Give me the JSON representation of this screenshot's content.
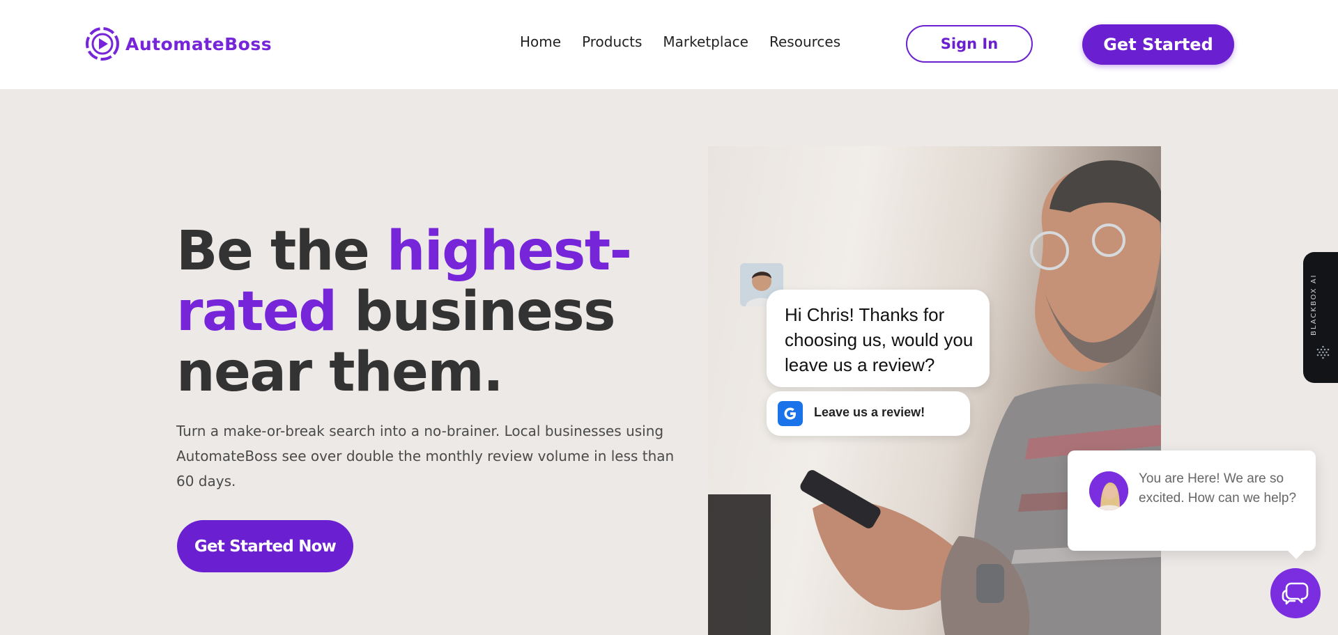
{
  "brand": {
    "name": "AutomateBoss",
    "color": "#7626d8"
  },
  "nav": {
    "items": [
      "Home",
      "Products",
      "Marketplace",
      "Resources"
    ]
  },
  "header": {
    "sign_in_label": "Sign In",
    "get_started_label": "Get Started"
  },
  "hero": {
    "title_part1": "Be the ",
    "title_accent1": "highest-",
    "title_accent2": "rated",
    "title_part2": " business",
    "title_part3": "near them.",
    "description": "Turn a make-or-break search into a no-brainer. Local businesses using AutomateBoss see over double the monthly review volume in less than 60 days.",
    "cta_label": "Get Started Now"
  },
  "image_overlay": {
    "message": "Hi Chris! Thanks for choosing us, would you leave us a review?",
    "review_button_label": "Leave us a review!",
    "google_icon": "google-g-icon"
  },
  "side_tab": {
    "label": "BLACKBOX AI"
  },
  "chat_widget": {
    "message": "You are Here! We are so excited. How can we help?",
    "icon": "chat-bubbles-icon"
  },
  "colors": {
    "primary": "#6a1fd0",
    "accent": "#7626d8",
    "background": "#ece9e7",
    "header_bg": "#ffffff"
  }
}
